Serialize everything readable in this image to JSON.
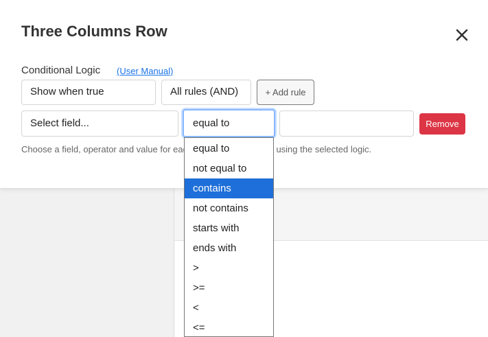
{
  "modal": {
    "title": "Three Columns Row",
    "close_icon": "close-icon"
  },
  "conditional_logic": {
    "label": "Conditional Logic",
    "manual_link": "(User Manual)",
    "show_mode": "Show when true",
    "rules_mode": "All rules (AND)",
    "add_rule_label": "+ Add rule"
  },
  "rule": {
    "field_value": "Select field...",
    "operator_value": "equal to",
    "value_input": "",
    "remove_label": "Remove"
  },
  "help": {
    "text": "Choose a field, operator and value for each rule. Rules combine using the selected logic."
  },
  "operator_options": [
    "equal to",
    "not equal to",
    "contains",
    "not contains",
    "starts with",
    "ends with",
    ">",
    ">=",
    "<",
    "<="
  ],
  "highlighted_option": "contains",
  "colors": {
    "remove_button": "#dc3545",
    "highlight": "#1e6fd9",
    "link": "#1a73e8",
    "focus_border": "#86b7fe"
  }
}
